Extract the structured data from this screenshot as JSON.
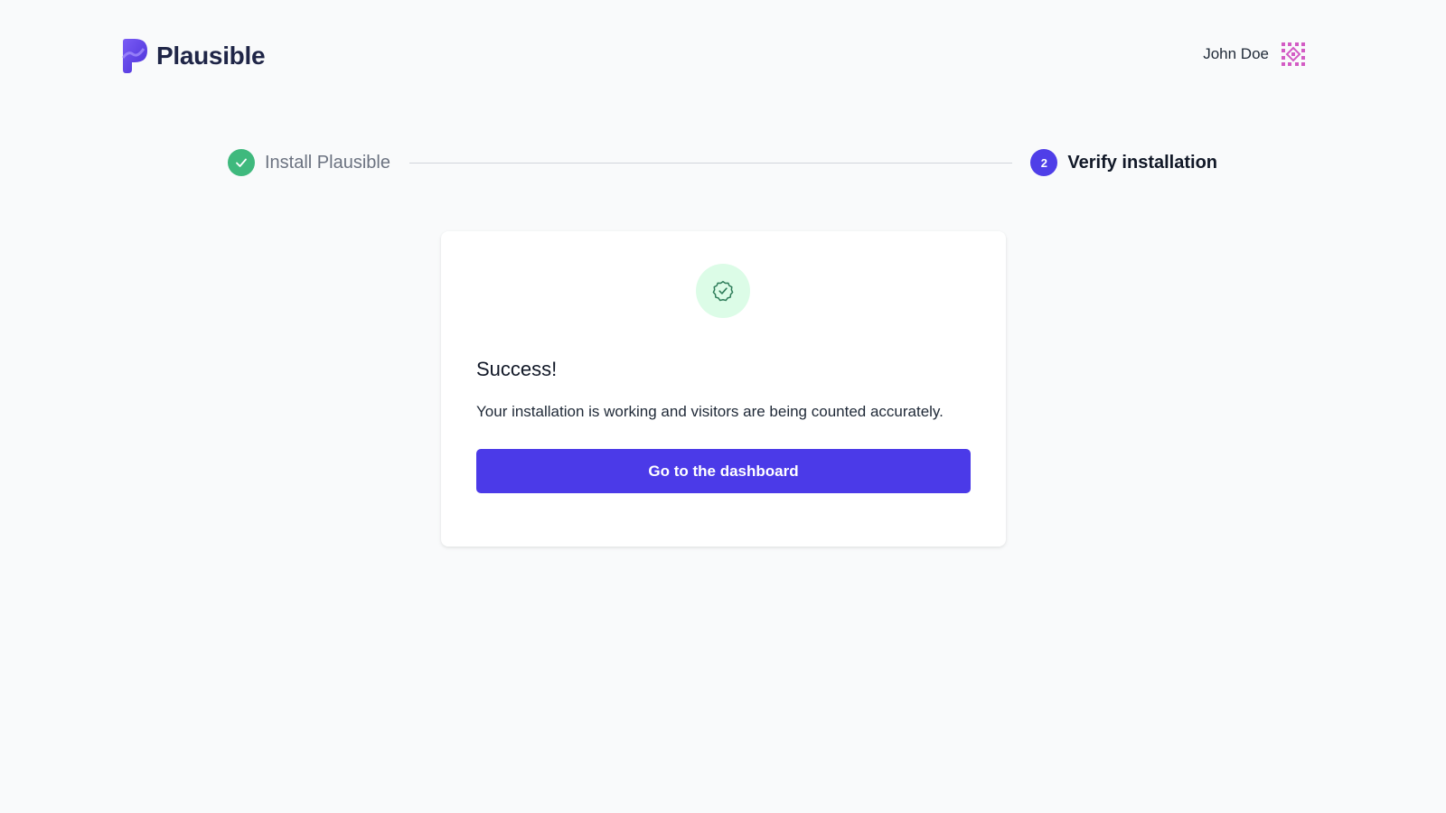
{
  "brand": {
    "name": "Plausible",
    "logo_icon": "plausible-p-logo-icon",
    "color": "#5a42e6"
  },
  "user": {
    "name": "John Doe",
    "avatar_icon": "pattern-avatar-icon"
  },
  "stepper": {
    "steps": [
      {
        "label": "Install Plausible",
        "status": "completed",
        "icon": "check-icon"
      },
      {
        "number": "2",
        "label": "Verify installation",
        "status": "active"
      }
    ],
    "completed_color": "#3fb97d",
    "active_color": "#4f3ee8"
  },
  "card": {
    "icon": "badge-check-icon",
    "title": "Success!",
    "message": "Your installation is working and visitors are being counted accurately.",
    "button_label": "Go to the dashboard",
    "button_color": "#4b3ae8"
  }
}
